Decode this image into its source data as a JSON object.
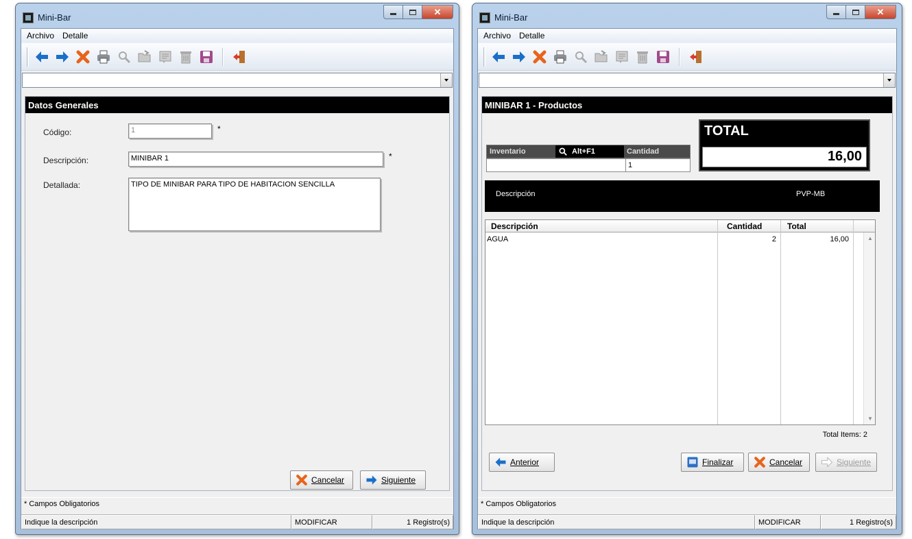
{
  "left_window": {
    "title": "Mini-Bar",
    "menu": [
      "Archivo",
      "Detalle"
    ],
    "panel_title": "Datos Generales",
    "fields": {
      "codigo_label": "Código:",
      "codigo_value": "1",
      "descripcion_label": "Descripción:",
      "descripcion_value": "MINIBAR 1",
      "detallada_label": "Detallada:",
      "detallada_value": "TIPO DE MINIBAR PARA TIPO DE HABITACION SENCILLA",
      "required_mark": "*"
    },
    "buttons": {
      "cancelar": "Cancelar",
      "siguiente": "Siguiente"
    },
    "footer_note": "* Campos Obligatorios",
    "status": {
      "hint": "Indique la descripción",
      "mode": "MODIFICAR",
      "records": "1 Registro(s)"
    }
  },
  "right_window": {
    "title": "Mini-Bar",
    "menu": [
      "Archivo",
      "Detalle"
    ],
    "panel_title": "MINIBAR 1 - Productos",
    "total_label": "TOTAL",
    "total_value": "16,00",
    "inventario_label": "Inventario",
    "shortcut": "Alt+F1",
    "cantidad_label": "Cantidad",
    "inventario_value": "",
    "cantidad_value": "1",
    "desc_bar": {
      "descripcion": "Descripción",
      "pvp": "PVP-MB"
    },
    "grid": {
      "headers": [
        "Descripción",
        "Cantidad",
        "Total"
      ],
      "rows": [
        {
          "descripcion": "AGUA",
          "cantidad": "2",
          "total": "16,00"
        }
      ]
    },
    "total_items": "Total Items: 2",
    "buttons": {
      "anterior": "Anterior",
      "finalizar": "Finalizar",
      "cancelar": "Cancelar",
      "siguiente": "Siguiente"
    },
    "footer_note": "* Campos Obligatorios",
    "status": {
      "hint": "Indique la descripción",
      "mode": "MODIFICAR",
      "records": "1 Registro(s)"
    }
  },
  "toolbar_icons": [
    "arrow-left-icon",
    "arrow-right-icon",
    "delete-icon",
    "print-icon",
    "search-icon",
    "open-folder-icon",
    "document-icon",
    "trash-icon",
    "save-icon",
    "exit-icon"
  ],
  "colors": {
    "accent_blue": "#1a6fc9",
    "delete_orange": "#e8641b",
    "panel_header": "#000000"
  }
}
